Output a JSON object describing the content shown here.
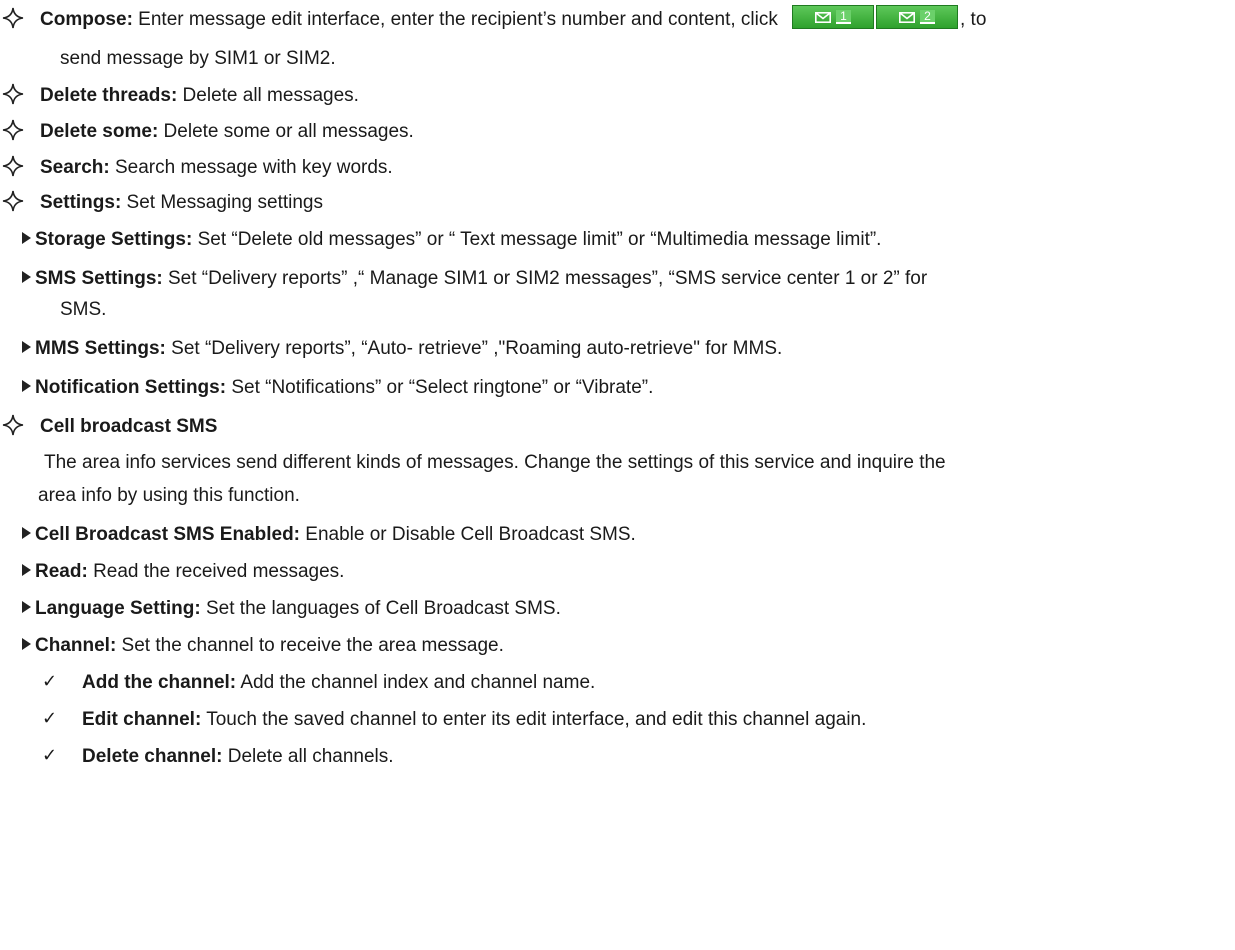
{
  "bullets": {
    "compose": {
      "label": "Compose:",
      "text": " Enter message edit interface, enter the recipient’s number and content, click",
      "after": ", to",
      "cont": "send message by SIM1 or SIM2.",
      "sim1": "1",
      "sim2": "2"
    },
    "delete_threads": {
      "label": "Delete threads:",
      "text": " Delete all messages."
    },
    "delete_some": {
      "label": "Delete some:",
      "text": " Delete some or all messages."
    },
    "search": {
      "label": "Search:",
      "text": " Search message with key words."
    },
    "settings": {
      "label": "Settings:",
      "text": " Set Messaging settings"
    },
    "cell_broadcast": {
      "label": "Cell broadcast SMS"
    }
  },
  "settings_items": {
    "storage": {
      "label": "Storage Settings:",
      "text": " Set “Delete old messages” or “ Text message limit” or “Multimedia message limit”."
    },
    "sms": {
      "label": "SMS Settings:",
      "text": " Set “Delivery reports” ,“ Manage SIM1 or SIM2 messages”, “SMS service center 1 or 2” for",
      "cont": "SMS."
    },
    "mms": {
      "label": "MMS Settings:",
      "text": " Set “Delivery reports”, “Auto- retrieve” ,\"Roaming auto-retrieve\" for MMS."
    },
    "notification": {
      "label": "Notification Settings:",
      "text": " Set “Notifications” or “Select ringtone” or “Vibrate”."
    }
  },
  "cell_broadcast_desc": {
    "line1": "The area info services send different kinds of messages. Change the settings of this service and inquire the",
    "line2": "area info by using this function."
  },
  "cb_items": {
    "enabled": {
      "label": "Cell Broadcast SMS Enabled:",
      "text": " Enable or Disable Cell Broadcast SMS."
    },
    "read": {
      "label": "Read:",
      "text": " Read the received messages."
    },
    "language": {
      "label": "Language Setting:",
      "text": " Set the languages of Cell Broadcast SMS."
    },
    "channel": {
      "label": "Channel:",
      "text": " Set the channel to receive the area message."
    }
  },
  "channel_items": {
    "add": {
      "label": "Add the channel:",
      "text": " Add the channel index and channel name."
    },
    "edit": {
      "label": "Edit channel:",
      "text": " Touch the saved channel to enter its edit interface, and edit this channel again."
    },
    "delete": {
      "label": "Delete channel:",
      "text": " Delete all channels."
    }
  },
  "glyphs": {
    "check": "✓"
  }
}
